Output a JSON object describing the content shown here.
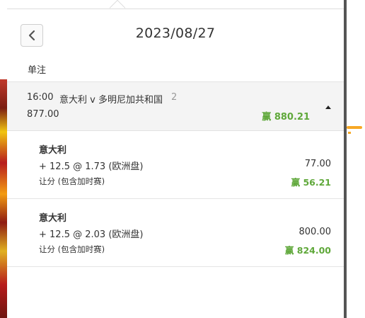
{
  "header": {
    "date": "2023/08/27",
    "back_icon": "chevron-left-icon"
  },
  "section_label": "单注",
  "bet": {
    "time": "16:00",
    "match": "意大利 v 多明尼加共和国",
    "leg_count": "2",
    "stake": "877.00",
    "win_label": "赢 880.21",
    "toggle_icon": "caret-up-icon"
  },
  "legs": [
    {
      "team": "意大利",
      "pick": "+ 12.5 @ 1.73 (欧洲盘)",
      "stake": "77.00",
      "market": "让分 (包含加时赛)",
      "win_label": "赢 56.21"
    },
    {
      "team": "意大利",
      "pick": "+ 12.5 @ 2.03 (欧洲盘)",
      "stake": "800.00",
      "market": "让分 (包含加时赛)",
      "win_label": "赢 824.00"
    }
  ],
  "colors": {
    "win_green": "#5fa83a",
    "accent_orange": "#f7a825"
  }
}
